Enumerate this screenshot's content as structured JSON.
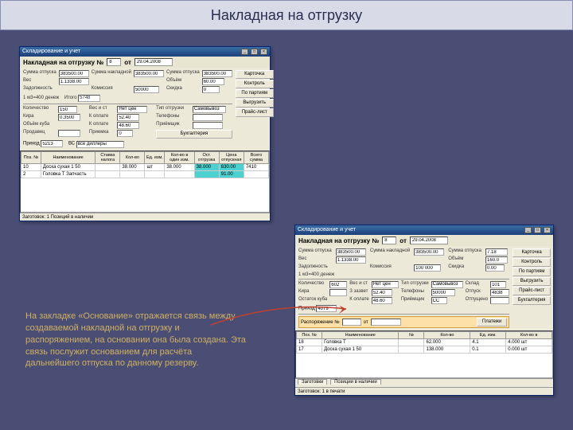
{
  "header": {
    "title": "Накладная на отгрузку"
  },
  "win1": {
    "titlebar": "Складирование и учет",
    "subtitle_prefix": "Накладная на отгрузку №",
    "doc_no": "8",
    "doc_date": "29.04.2008",
    "word_ot": "от",
    "rows": {
      "r1_a": "Сумма отпуска",
      "r1_av": "383500.00",
      "r1_b": "Сумма накладной",
      "r1_bv": "383500.00",
      "r1_c": "Сумма отпуска",
      "r1_cv": "383500.00",
      "r2_a": "Вес",
      "r2_av": "1.1338.00",
      "r2_c": "Объём",
      "r2_cv": "60.00",
      "r2_d": "1 м3=400 денеж",
      "r3_a": "Задолжность",
      "r3_c": "Комиссия",
      "r3_cv": "50000",
      "r3_d": "Скидка",
      "r3_dv": "0",
      "r3_e": "Итого",
      "r3_ev": "5748",
      "r4_a": "Количество",
      "r4_av": "150",
      "r4_b": "Вес и ст",
      "r4_bv": "Нет цен",
      "r4_c": "Тип отгрузки",
      "r4_cv": "Самовывоз",
      "r4_e": "Приход",
      "r4_ev": "5213",
      "r5_a": "Кира",
      "r5_av": "0.3500",
      "r5_b": "К оплате",
      "r5_bv": "52.40",
      "r5_c": "Телефоны",
      "r6_a": "Объём куба",
      "r6_b": "К оплате",
      "r6_bv": "48.60",
      "r6_c": "Приёмщик",
      "r7_a": "Продавец",
      "r7_b": "Приемка",
      "r7_bv": "0",
      "btn_bux": "Бухгалтерия"
    },
    "buttons": [
      "Карточка",
      "Контроль",
      "По партиям",
      "Выгрузить",
      "Прайс-лист"
    ],
    "dropdown_label": "ВС",
    "dropdown_val": "все диллеры",
    "table": {
      "headers": [
        "Поз. №",
        "Наименование",
        "Ставка налога",
        "Кол-во",
        "Ед. изм.",
        "Кол-во в один изм.",
        "Ост. отгрузка",
        "Цена отпускная",
        "Всего сумма"
      ],
      "rows": [
        [
          "10",
          "Доска сухая 1 50",
          "",
          "38.000",
          "шт",
          "38.000",
          "38.000",
          "630.00",
          "7410"
        ],
        [
          "2",
          "Головка Т Запчасть",
          "",
          "",
          "",
          "",
          "",
          "91.00",
          ""
        ]
      ]
    },
    "status": "Заготовок: 1 Позиций в наличии"
  },
  "win2": {
    "titlebar": "Складирование и учет",
    "subtitle_prefix": "Накладная на отгрузку №",
    "doc_no": "8",
    "doc_date": "29.04.2008",
    "word_ot": "от",
    "rows": {
      "r1_a": "Сумма отпуска",
      "r1_av": "383500.00",
      "r1_b": "Сумма накладной",
      "r1_bv": "383500.00",
      "r1_c": "Сумма отпуска",
      "r1_cv": "7.18",
      "r2_a": "Вес",
      "r2_av": "1.1338.00",
      "r2_c": "Объём",
      "r2_cv": "160.0",
      "r2_d": "1 м3=400 денеж",
      "r3_a": "Задолжность",
      "r3_c": "Комиссия",
      "r3_cv": "100 000",
      "r3_d": "Скидка",
      "r3_dv": "0.00",
      "r4_a": "Количество",
      "r4_av": "602",
      "r4_b": "Вес и ст",
      "r4_bv": "Нет цен",
      "r4_c": "Тип отгрузки",
      "r4_cv": "Самовывоз",
      "r4_d": "Склад",
      "r4_dv": "101",
      "r4_e": "Приход",
      "r4_ev": "4079",
      "r5_a": "Кира",
      "r5_b": "З зазвет",
      "r5_bv": "52.40",
      "r5_c": "Телефоны",
      "r5_cv": "50000",
      "r5_d": "Отпуск",
      "r5_dv": "4838",
      "r6_a": "Остаток куба",
      "r6_b": "К оплате",
      "r6_bv": "48.60",
      "r6_c": "Приёмщик",
      "r6_cv": "СС",
      "r6_d": "Отпущено",
      "r7_a": "Продавец",
      "r7_b": "Приемка",
      "r7_bv": "0",
      "rasp_label": "Распоряжение №",
      "rasp_no": "",
      "rasp_ot": "от",
      "rasp_date": "",
      "btn_pay": "Платежи"
    },
    "buttons": [
      "Карточка",
      "Контроль",
      "По партиям",
      "Выгрузить",
      "Прайс-лист",
      "Бухгалтерия"
    ],
    "table": {
      "headers": [
        "Поз. №",
        "Наименование",
        "№",
        "Кол-во",
        "Ед. изм.",
        "Кол-во в"
      ],
      "rows": [
        [
          "18",
          "Головка Т",
          "",
          "62.000",
          "4.1",
          "4.000 шт"
        ],
        [
          "17",
          "Доска сухая 1 50",
          "",
          "138.000",
          "0.1",
          "0.000 шт"
        ]
      ]
    },
    "tabs": [
      "Заготовки",
      "Позиции в наличии"
    ],
    "status": "Заготовок: 1 в печати"
  },
  "caption": "На закладке «Основание» отражается связь между создаваемой накладной на отгрузку и распоряжением, на основании она была создана. Эта связь послужит основанием для расчёта дальнейшего отпуска по данному резерву."
}
